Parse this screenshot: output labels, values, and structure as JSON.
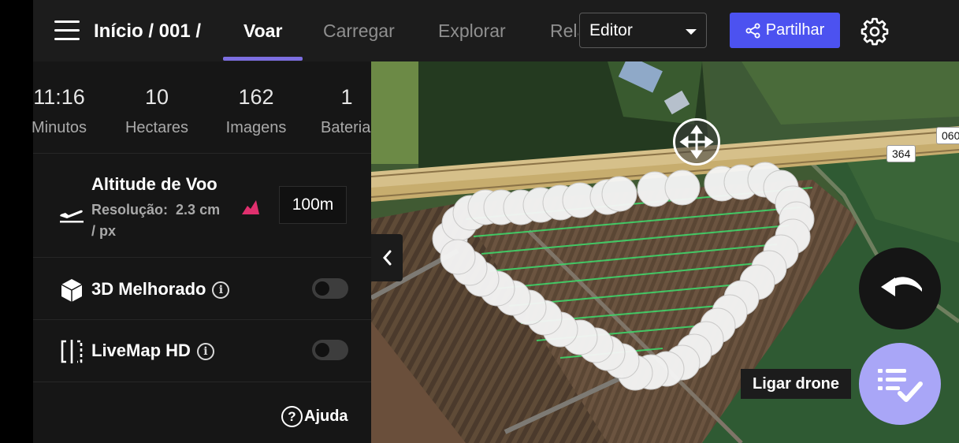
{
  "header": {
    "breadcrumb": "Início / 001 /",
    "tabs": [
      {
        "label": "Voar",
        "active": true
      },
      {
        "label": "Carregar",
        "active": false
      },
      {
        "label": "Explorar",
        "active": false
      },
      {
        "label": "Relatórios",
        "active": false
      }
    ],
    "mode_select": {
      "value": "Editor"
    },
    "share_label": "Partilhar",
    "accent_color": "#4c52f0",
    "tab_indicator_color": "#7c6ee0",
    "icons": {
      "menu": "hamburger-icon",
      "share": "share-icon",
      "settings": "gear-icon"
    }
  },
  "stats": [
    {
      "value": "11:16",
      "label": "Minutos"
    },
    {
      "value": "10",
      "label": "Hectares"
    },
    {
      "value": "162",
      "label": "Imagens"
    },
    {
      "value": "1",
      "label": "Bateria"
    }
  ],
  "altitude": {
    "title": "Altitude de Voo",
    "resolution_label": "Resolução:",
    "resolution_value": "2.3 cm",
    "resolution_unit": "/ px",
    "value": "100m",
    "terrain_icon_color": "#e0306e"
  },
  "options": [
    {
      "label": "3D Melhorado",
      "enabled": false,
      "icon": "cube-icon"
    },
    {
      "label": "LiveMap HD",
      "enabled": false,
      "icon": "livemap-icon"
    }
  ],
  "help_label": "Ajuda",
  "map": {
    "road_labels": [
      "364",
      "060"
    ],
    "connect_drone_label": "Ligar drone",
    "connect_button_color": "#a9a6f7"
  }
}
